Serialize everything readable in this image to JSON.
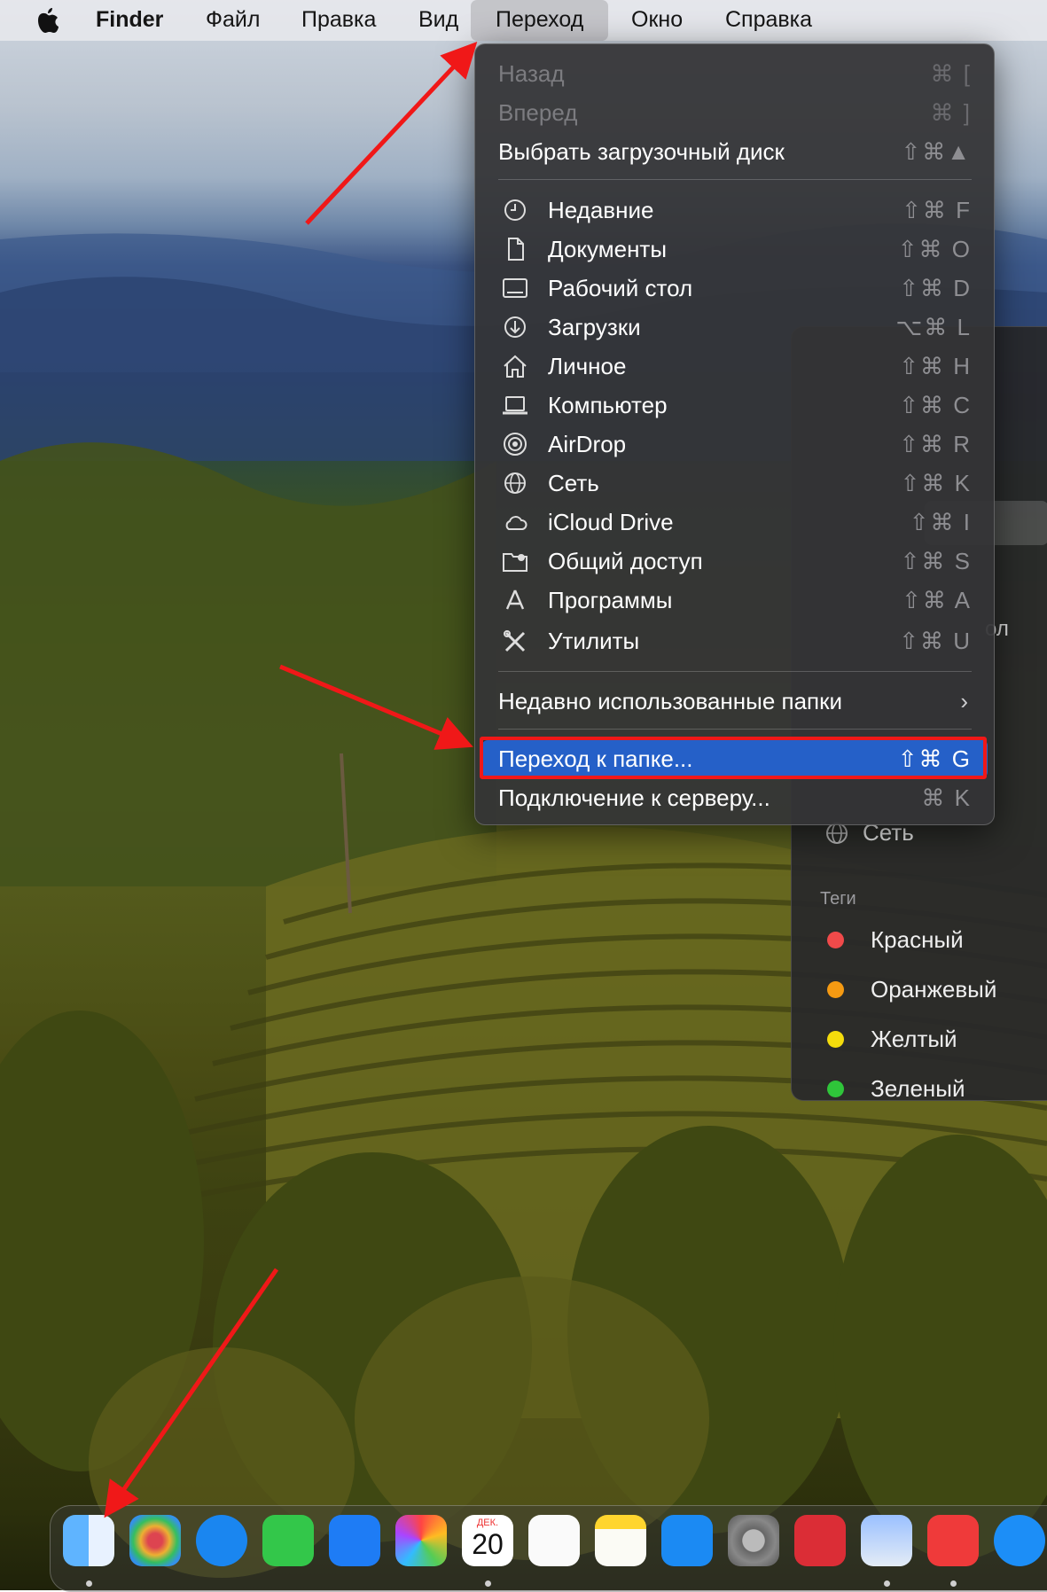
{
  "menubar": {
    "app_name": "Finder",
    "items": [
      "Файл",
      "Правка",
      "Вид",
      "Переход",
      "Окно",
      "Справка"
    ]
  },
  "go_menu": {
    "back": {
      "label": "Назад",
      "shortcut": "⌘ ["
    },
    "forward": {
      "label": "Вперед",
      "shortcut": "⌘ ]"
    },
    "startup_disk": {
      "label": "Выбрать загрузочный диск",
      "shortcut": "⇧⌘▲"
    },
    "places": [
      {
        "label": "Недавние",
        "shortcut": "⇧⌘ F",
        "icon": "clock-icon"
      },
      {
        "label": "Документы",
        "shortcut": "⇧⌘ O",
        "icon": "document-icon"
      },
      {
        "label": "Рабочий стол",
        "shortcut": "⇧⌘ D",
        "icon": "desktop-icon"
      },
      {
        "label": "Загрузки",
        "shortcut": "⌥⌘ L",
        "icon": "download-icon"
      },
      {
        "label": "Личное",
        "shortcut": "⇧⌘ H",
        "icon": "home-icon"
      },
      {
        "label": "Компьютер",
        "shortcut": "⇧⌘ C",
        "icon": "laptop-icon"
      },
      {
        "label": "AirDrop",
        "shortcut": "⇧⌘ R",
        "icon": "airdrop-icon"
      },
      {
        "label": "Сеть",
        "shortcut": "⇧⌘ K",
        "icon": "globe-icon"
      },
      {
        "label": "iCloud Drive",
        "shortcut": "⇧⌘ I",
        "icon": "cloud-icon"
      },
      {
        "label": "Общий доступ",
        "shortcut": "⇧⌘ S",
        "icon": "shared-folder-icon"
      },
      {
        "label": "Программы",
        "shortcut": "⇧⌘ A",
        "icon": "applications-icon"
      },
      {
        "label": "Утилиты",
        "shortcut": "⇧⌘ U",
        "icon": "utilities-icon"
      }
    ],
    "recent_folders": {
      "label": "Недавно использованные папки",
      "chevron": "›"
    },
    "go_to_folder": {
      "label": "Переход к папке...",
      "shortcut": "⇧⌘ G"
    },
    "connect_server": {
      "label": "Подключение к серверу...",
      "shortcut": "⌘ K"
    }
  },
  "finder_sidebar": {
    "partial_label": "ол",
    "network": "Сеть",
    "tags_header": "Теги",
    "tags": [
      {
        "label": "Красный",
        "color": "#f04a4a"
      },
      {
        "label": "Оранжевый",
        "color": "#f59a12"
      },
      {
        "label": "Желтый",
        "color": "#f4dc0c"
      },
      {
        "label": "Зеленый",
        "color": "#2fc53a"
      }
    ]
  },
  "dock": {
    "calendar_month": "ДЕК.",
    "calendar_day": "20",
    "apps": [
      "finder",
      "launchpad",
      "safari",
      "messages",
      "mail",
      "photos",
      "calendar",
      "reminders",
      "notes",
      "app-store",
      "system-settings",
      "expressvpn",
      "preview",
      "anydesk",
      "teamviewer"
    ]
  },
  "colors": {
    "highlight": "#2560c8",
    "annotation": "#f01818"
  }
}
